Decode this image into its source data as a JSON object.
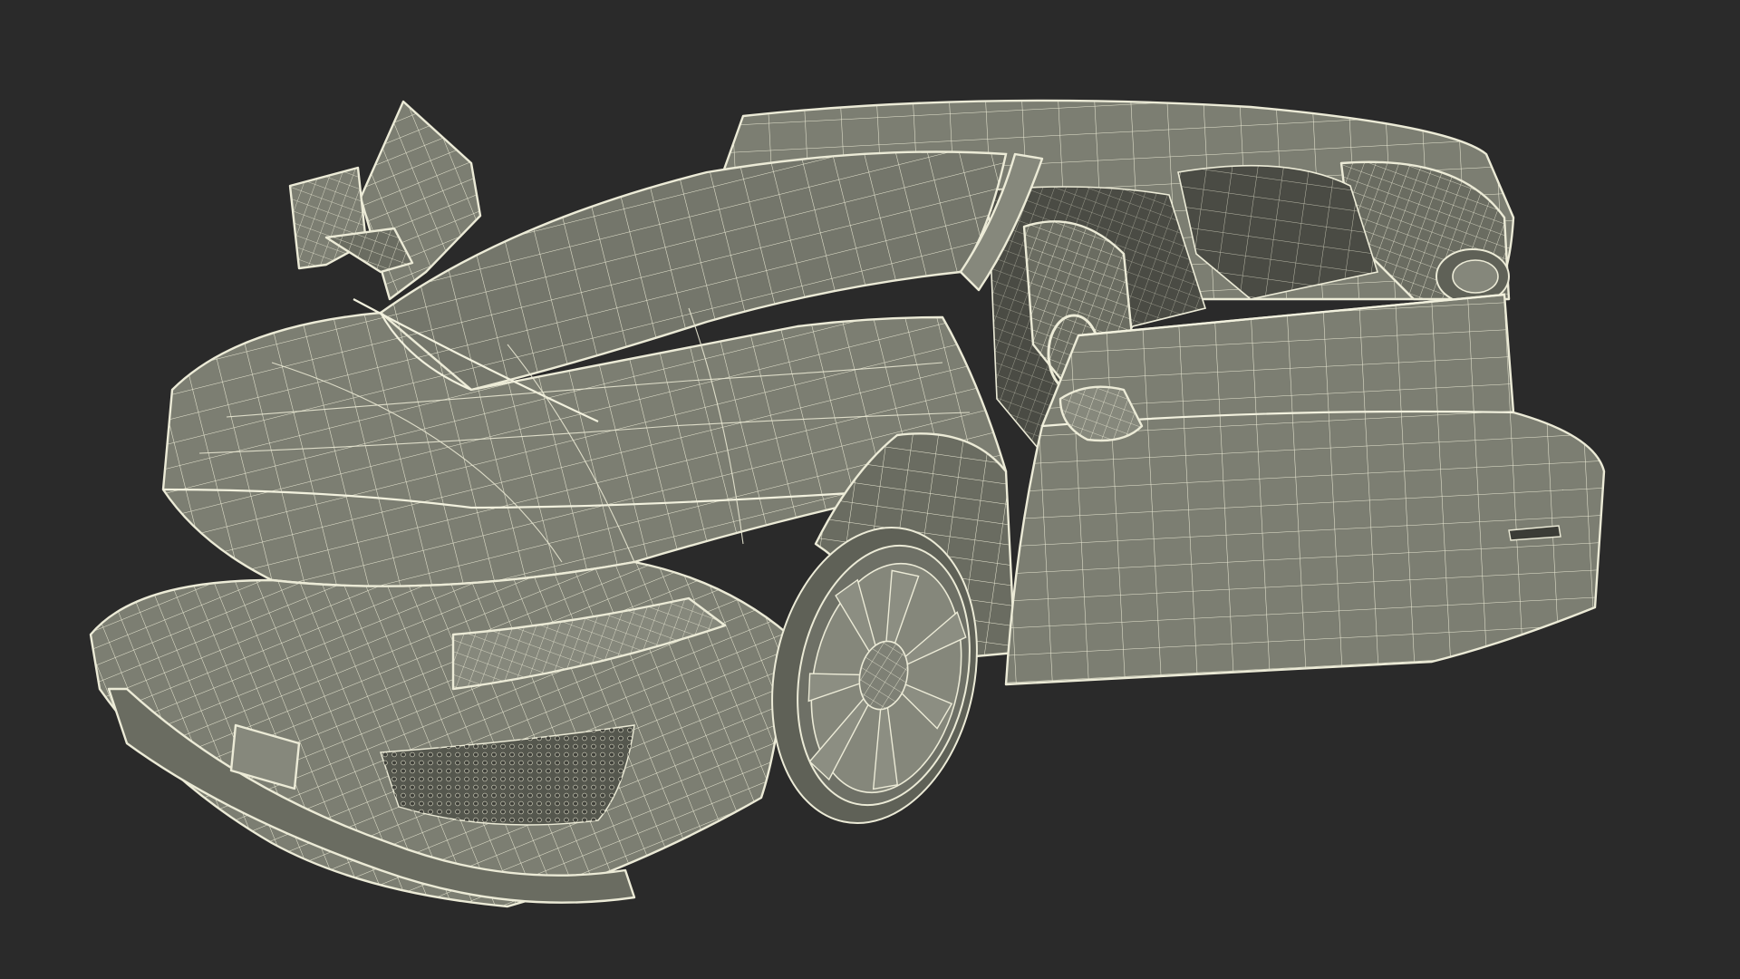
{
  "scene": {
    "background_color": "#2a2a2a",
    "mesh_fill_color": "#7c7e72",
    "wire_color": "#ecebd7",
    "subject": "sports-car-wireframe"
  }
}
